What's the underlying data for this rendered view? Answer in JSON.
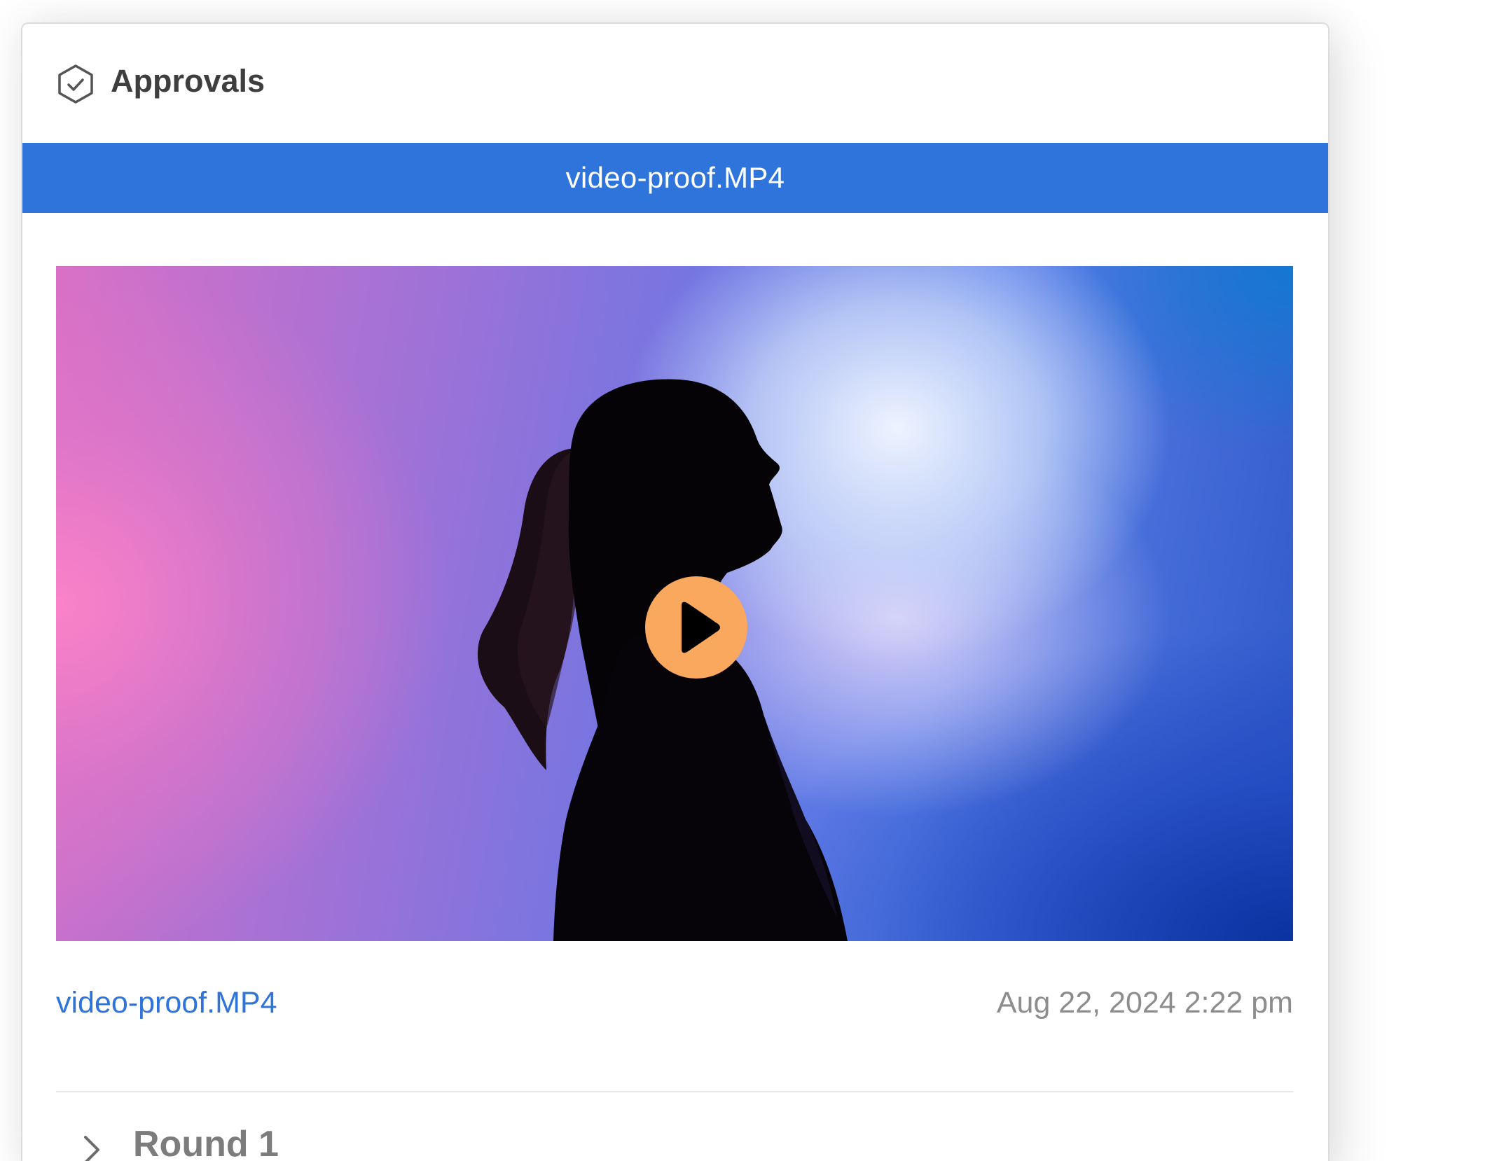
{
  "header": {
    "title": "Approvals",
    "icon": "approval-shield-check-icon"
  },
  "file_bar": {
    "label": "video-proof.MP4",
    "color": "#2e74db"
  },
  "media": {
    "play_icon": "play-icon",
    "play_button_color": "#f9a85d"
  },
  "meta": {
    "file_name": "video-proof.MP4",
    "timestamp": "Aug 22, 2024 2:22 pm"
  },
  "rounds": {
    "label": "Round 1",
    "icon": "chevron-right-icon"
  }
}
